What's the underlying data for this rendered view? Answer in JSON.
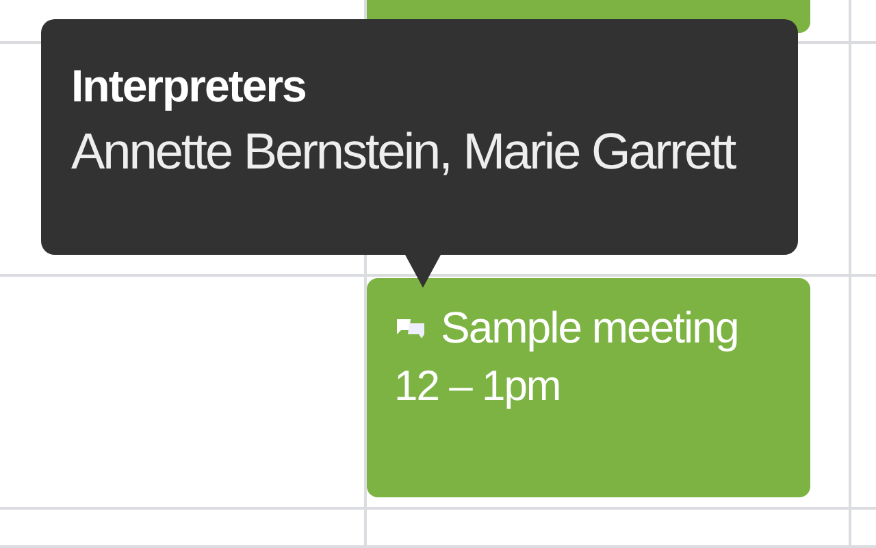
{
  "tooltip": {
    "title": "Interpreters",
    "text": "Annette Bernstein, Marie Garrett"
  },
  "event": {
    "title": "Sample meeting",
    "time": "12 – 1pm",
    "icon": true
  }
}
